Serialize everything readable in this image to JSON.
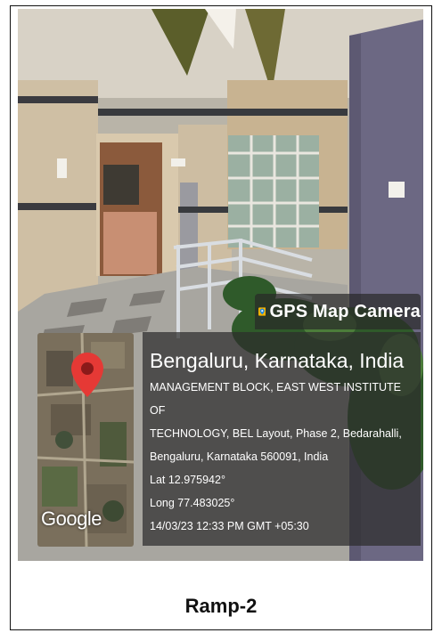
{
  "overlay": {
    "app_name": "GPS Map Camera",
    "map_brand": "Google",
    "city": "Bengaluru, Karnataka, India",
    "address_lines": [
      "MANAGEMENT BLOCK, EAST WEST INSTITUTE OF",
      "TECHNOLOGY, BEL Layout, Phase 2, Bedarahalli,",
      "Bengaluru, Karnataka 560091, India"
    ],
    "latitude": "Lat 12.975942°",
    "longitude": "Long 77.483025°",
    "timestamp": "14/03/23 12:33 PM GMT +05:30"
  },
  "caption": "Ramp-2",
  "colors": {
    "pin_red": "#e53935",
    "overlay_bg": "#2d2d2d",
    "wall_purple": "#6f6a86",
    "stone": "#c9b79c"
  }
}
